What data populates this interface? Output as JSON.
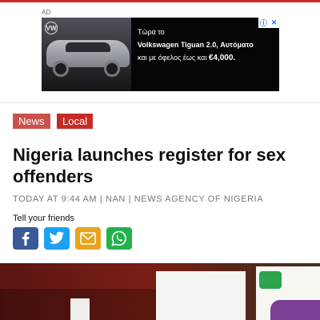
{
  "ad": {
    "label": "AD",
    "line1": "Τώρα το",
    "line2": "Volkswagen Tiguan 2.0, Αυτόματο",
    "line3_prefix": "και με όφελος έως και ",
    "line3_amount": "€4,000.",
    "brand_logo": "VW",
    "icons": [
      "info-icon",
      "close-icon"
    ]
  },
  "tags": [
    {
      "label": "News",
      "color": "#c9524c"
    },
    {
      "label": "Local",
      "color": "#c52b26"
    }
  ],
  "article": {
    "title": "Nigeria launches register for sex offenders",
    "meta": "TODAY AT 9:44 AM | NAN | NEWS AGENCY OF NIGERIA"
  },
  "share": {
    "label": "Tell your friends",
    "buttons": [
      {
        "icon": "facebook-icon",
        "color": "#3b5998"
      },
      {
        "icon": "twitter-icon",
        "color": "#1da1f2"
      },
      {
        "icon": "email-icon",
        "color": "#e8a31c"
      },
      {
        "icon": "whatsapp-icon",
        "color": "#22b14c"
      }
    ]
  },
  "colors": {
    "accent": "#c52b26"
  }
}
